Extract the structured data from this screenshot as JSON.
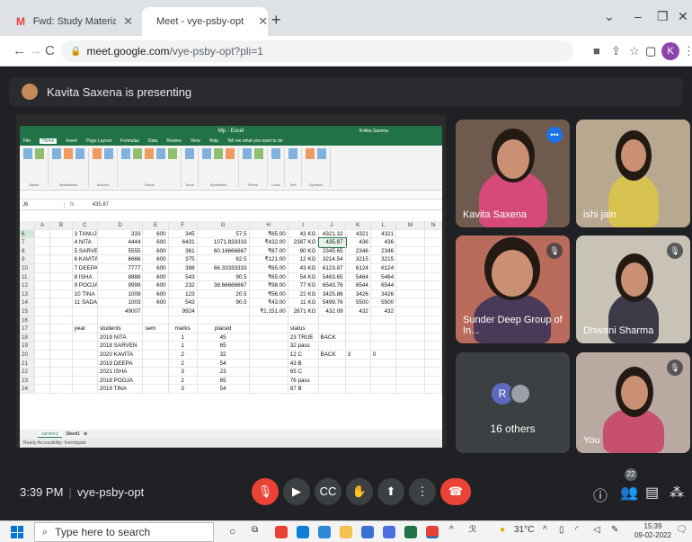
{
  "browser": {
    "tabs": [
      {
        "title": "Fwd: Study Materials for Particip",
        "favicon": "gmail-icon",
        "color": "#ea4335"
      },
      {
        "title": "Meet - vye-psby-opt",
        "favicon": "meet-icon",
        "color": "#00832d"
      }
    ],
    "url_host": "meet.google.com",
    "url_path": "/vye-psby-opt?pli=1",
    "profile_initial": "K"
  },
  "meet": {
    "presenting_text": "Kavita Saxena is presenting",
    "time": "3:39 PM",
    "meeting_code": "vye-psby-opt",
    "participants_badge": "22",
    "others_label": "16 others",
    "others_avatar": "R",
    "tiles": [
      {
        "name": "Kavita Saxena"
      },
      {
        "name": "ishi jain"
      },
      {
        "name": "Sunder Deep Group of In..."
      },
      {
        "name": "Dhwani Sharma"
      },
      {
        "name": "You"
      }
    ]
  },
  "excel": {
    "title": "Mp - Excel",
    "user": "Kritika Saxena",
    "menu": [
      "File",
      "Home",
      "Insert",
      "Page Layout",
      "Formulas",
      "Data",
      "Review",
      "View",
      "Help",
      "Tell me what you want to do"
    ],
    "selected_menu": "Home",
    "ribbon_groups": [
      "Tables",
      "Illustrations",
      "Add-ins",
      "Charts",
      "Tours",
      "Sparklines",
      "Filters",
      "Links",
      "Text",
      "Symbols"
    ],
    "namebox": "J6",
    "formula": "435.87",
    "columns": [
      "A",
      "B",
      "C",
      "D",
      "E",
      "F",
      "G",
      "H",
      "I",
      "J",
      "K",
      "L",
      "M",
      "N"
    ],
    "rows": [
      {
        "n": "6",
        "c": [
          "",
          "",
          "3 TANUJ",
          "333",
          "600",
          "345",
          "57.5",
          "₹65.00",
          "43 KG",
          "4321.32",
          "4321",
          "4321",
          "",
          ""
        ]
      },
      {
        "n": "7",
        "c": [
          "",
          "",
          "4 NITA",
          "4444",
          "600",
          "6431",
          "1071.833333",
          "₹432.00",
          "2387 KG",
          "435.87",
          "436",
          "436",
          "",
          ""
        ]
      },
      {
        "n": "8",
        "c": [
          "",
          "",
          "5 SARVEN",
          "5555",
          "600",
          "361",
          "60.16666667",
          "₹87.00",
          "90 KG",
          "2345.65",
          "2346",
          "2346",
          "",
          ""
        ]
      },
      {
        "n": "9",
        "c": [
          "",
          "",
          "6 KAVITA",
          "6666",
          "600",
          "375",
          "62.5",
          "₹121.00",
          "12 KG",
          "3214.54",
          "3215",
          "3215",
          "",
          ""
        ]
      },
      {
        "n": "10",
        "c": [
          "",
          "",
          "7 DEEPA",
          "7777",
          "600",
          "398",
          "66.33333333",
          "₹65.00",
          "43 KG",
          "6123.87",
          "6124",
          "6124",
          "",
          ""
        ]
      },
      {
        "n": "11",
        "c": [
          "",
          "",
          "8 ISHA",
          "8888",
          "600",
          "543",
          "90.5",
          "₹65.00",
          "54 KG",
          "5463.65",
          "5464",
          "5464",
          "",
          ""
        ]
      },
      {
        "n": "12",
        "c": [
          "",
          "",
          "9 POOJA",
          "9999",
          "600",
          "232",
          "38.66666667",
          "₹98.00",
          "77 KG",
          "6543.76",
          "6544",
          "6544",
          "",
          ""
        ]
      },
      {
        "n": "13",
        "c": [
          "",
          "",
          "10 TINA",
          "1009",
          "600",
          "123",
          "20.5",
          "₹56.00",
          "22 KG",
          "3425.86",
          "3426",
          "3426",
          "",
          ""
        ]
      },
      {
        "n": "14",
        "c": [
          "",
          "",
          "11 SADAF",
          "1003",
          "600",
          "543",
          "90.5",
          "₹43.00",
          "11 KG",
          "5499.76",
          "5500",
          "5500",
          "",
          ""
        ]
      },
      {
        "n": "15",
        "c": [
          "",
          "",
          "",
          "49007",
          "",
          "9924",
          "",
          "₹1,151.00",
          "2871 KG",
          "432.09",
          "432",
          "432",
          "",
          ""
        ]
      },
      {
        "n": "16",
        "c": [
          "",
          "",
          "",
          "",
          "",
          "",
          "",
          "",
          "",
          "",
          "",
          "",
          "",
          ""
        ]
      },
      {
        "n": "17",
        "c": [
          "",
          "",
          "year",
          "students",
          "sem",
          "marks",
          "placed",
          "",
          "status",
          "",
          "",
          "",
          "",
          ""
        ]
      },
      {
        "n": "18",
        "c": [
          "",
          "",
          "",
          "2019 NITA",
          "",
          "1",
          "45",
          "",
          "23  TRUE",
          "BACK",
          "",
          "",
          "",
          ""
        ]
      },
      {
        "n": "19",
        "c": [
          "",
          "",
          "",
          "2018 SARVEN",
          "",
          "1",
          "65",
          "",
          "32 pass",
          "",
          "",
          "",
          "",
          ""
        ]
      },
      {
        "n": "20",
        "c": [
          "",
          "",
          "",
          "2020 KAVITA",
          "",
          "2",
          "32",
          "",
          "12 C",
          "BACK",
          "3",
          "0",
          "",
          ""
        ]
      },
      {
        "n": "21",
        "c": [
          "",
          "",
          "",
          "2019 DEEPA",
          "",
          "2",
          "54",
          "",
          "43 B",
          "",
          "",
          "",
          "",
          ""
        ]
      },
      {
        "n": "22",
        "c": [
          "",
          "",
          "",
          "2021 ISHA",
          "",
          "3",
          "23",
          "",
          "65 C",
          "",
          "",
          "",
          "",
          ""
        ]
      },
      {
        "n": "23",
        "c": [
          "",
          "",
          "",
          "2018 POOJA",
          "",
          "2",
          "65",
          "",
          "76 pass",
          "",
          "",
          "",
          "",
          ""
        ]
      },
      {
        "n": "24",
        "c": [
          "",
          "",
          "",
          "2019 TINA",
          "",
          "3",
          "54",
          "",
          "87 B",
          "",
          "",
          "",
          "",
          ""
        ]
      }
    ],
    "sheets": [
      "currency",
      "Sheet1"
    ],
    "status": "Ready   Accessibility: Investigate"
  },
  "taskbar": {
    "search_placeholder": "Type here to search",
    "temperature": "31°C",
    "clock_time": "15:39",
    "clock_date": "09-02-2022"
  }
}
